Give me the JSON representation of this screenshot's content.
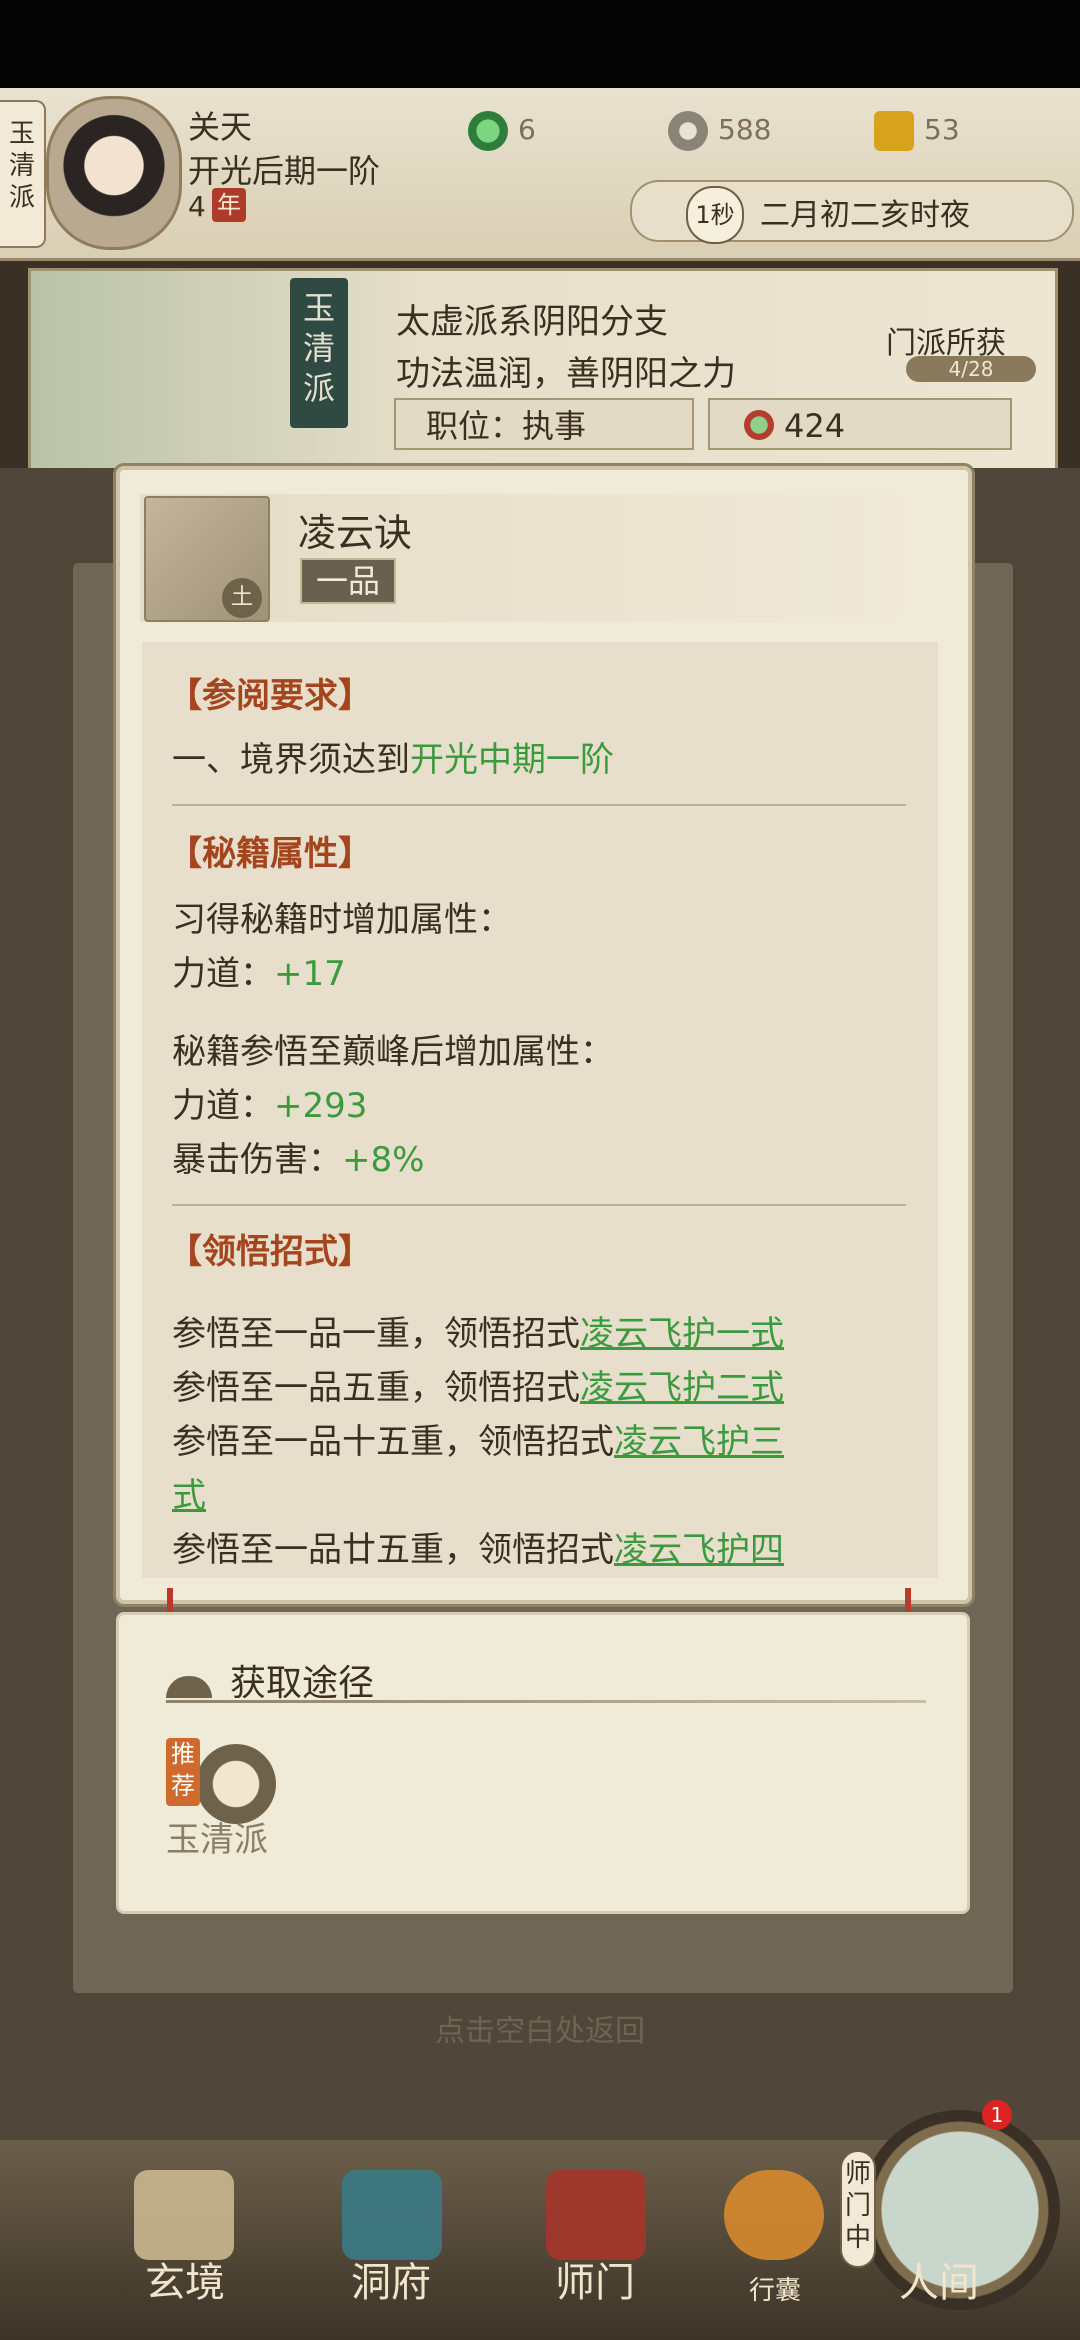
{
  "header": {
    "sect_tab": "玉清派",
    "player_name": "关天",
    "realm": "开光后期一阶",
    "age_value": "4",
    "age_unit": "年",
    "resources": [
      {
        "icon": "spirit-stone-icon",
        "value": "6"
      },
      {
        "icon": "coin-icon",
        "value": "588"
      },
      {
        "icon": "gold-cup-icon",
        "value": "53"
      }
    ],
    "time_seconds": "1秒",
    "time_text": "二月初二亥时夜"
  },
  "sect": {
    "flag": "玉清派",
    "desc_line1": "太虚派系阴阳分支",
    "desc_line2": "功法温润，善阴阳之力",
    "gain_label": "门派所获",
    "gain_count": "4/28",
    "position_label": "职位：执事",
    "contribution": "424"
  },
  "modal": {
    "book_name": "凌云诀",
    "book_grade": "一品",
    "book_element": "土",
    "requirements_title": "【参阅要求】",
    "requirement_prefix": "一、境界须达到",
    "requirement_value": "开光中期一阶",
    "attributes_title": "【秘籍属性】",
    "learn_label": "习得秘籍时增加属性：",
    "learn_attr_name": "力道：",
    "learn_attr_value": "+17",
    "peak_label": "秘籍参悟至巅峰后增加属性：",
    "peak_attrs": [
      {
        "name": "力道：",
        "value": "+293"
      },
      {
        "name": "暴击伤害：",
        "value": "+8%"
      }
    ],
    "moves_title": "【领悟招式】",
    "moves": [
      {
        "prefix": "参悟至一品一重，领悟招式",
        "move": "凌云飞护一式"
      },
      {
        "prefix": "参悟至一品五重，领悟招式",
        "move": "凌云飞护二式"
      },
      {
        "prefix": "参悟至一品十五重，领悟招式",
        "move": "凌云飞护三",
        "move_cont": "式"
      },
      {
        "prefix": "参悟至一品廿五重，领悟招式",
        "move": "凌云飞护四"
      }
    ]
  },
  "source": {
    "title": "获取途径",
    "recommend": "推荐",
    "item_name": "玉清派"
  },
  "dismiss_hint": "点击空白处返回",
  "nav": {
    "items": [
      "玄境",
      "洞府",
      "师门",
      "行囊",
      "人间"
    ],
    "mentor_tag": "师门中",
    "badge": "1"
  },
  "colors": {
    "accent_green": "#3b9a3e",
    "section_title": "#a4451d",
    "panel": "#f0ead9"
  }
}
